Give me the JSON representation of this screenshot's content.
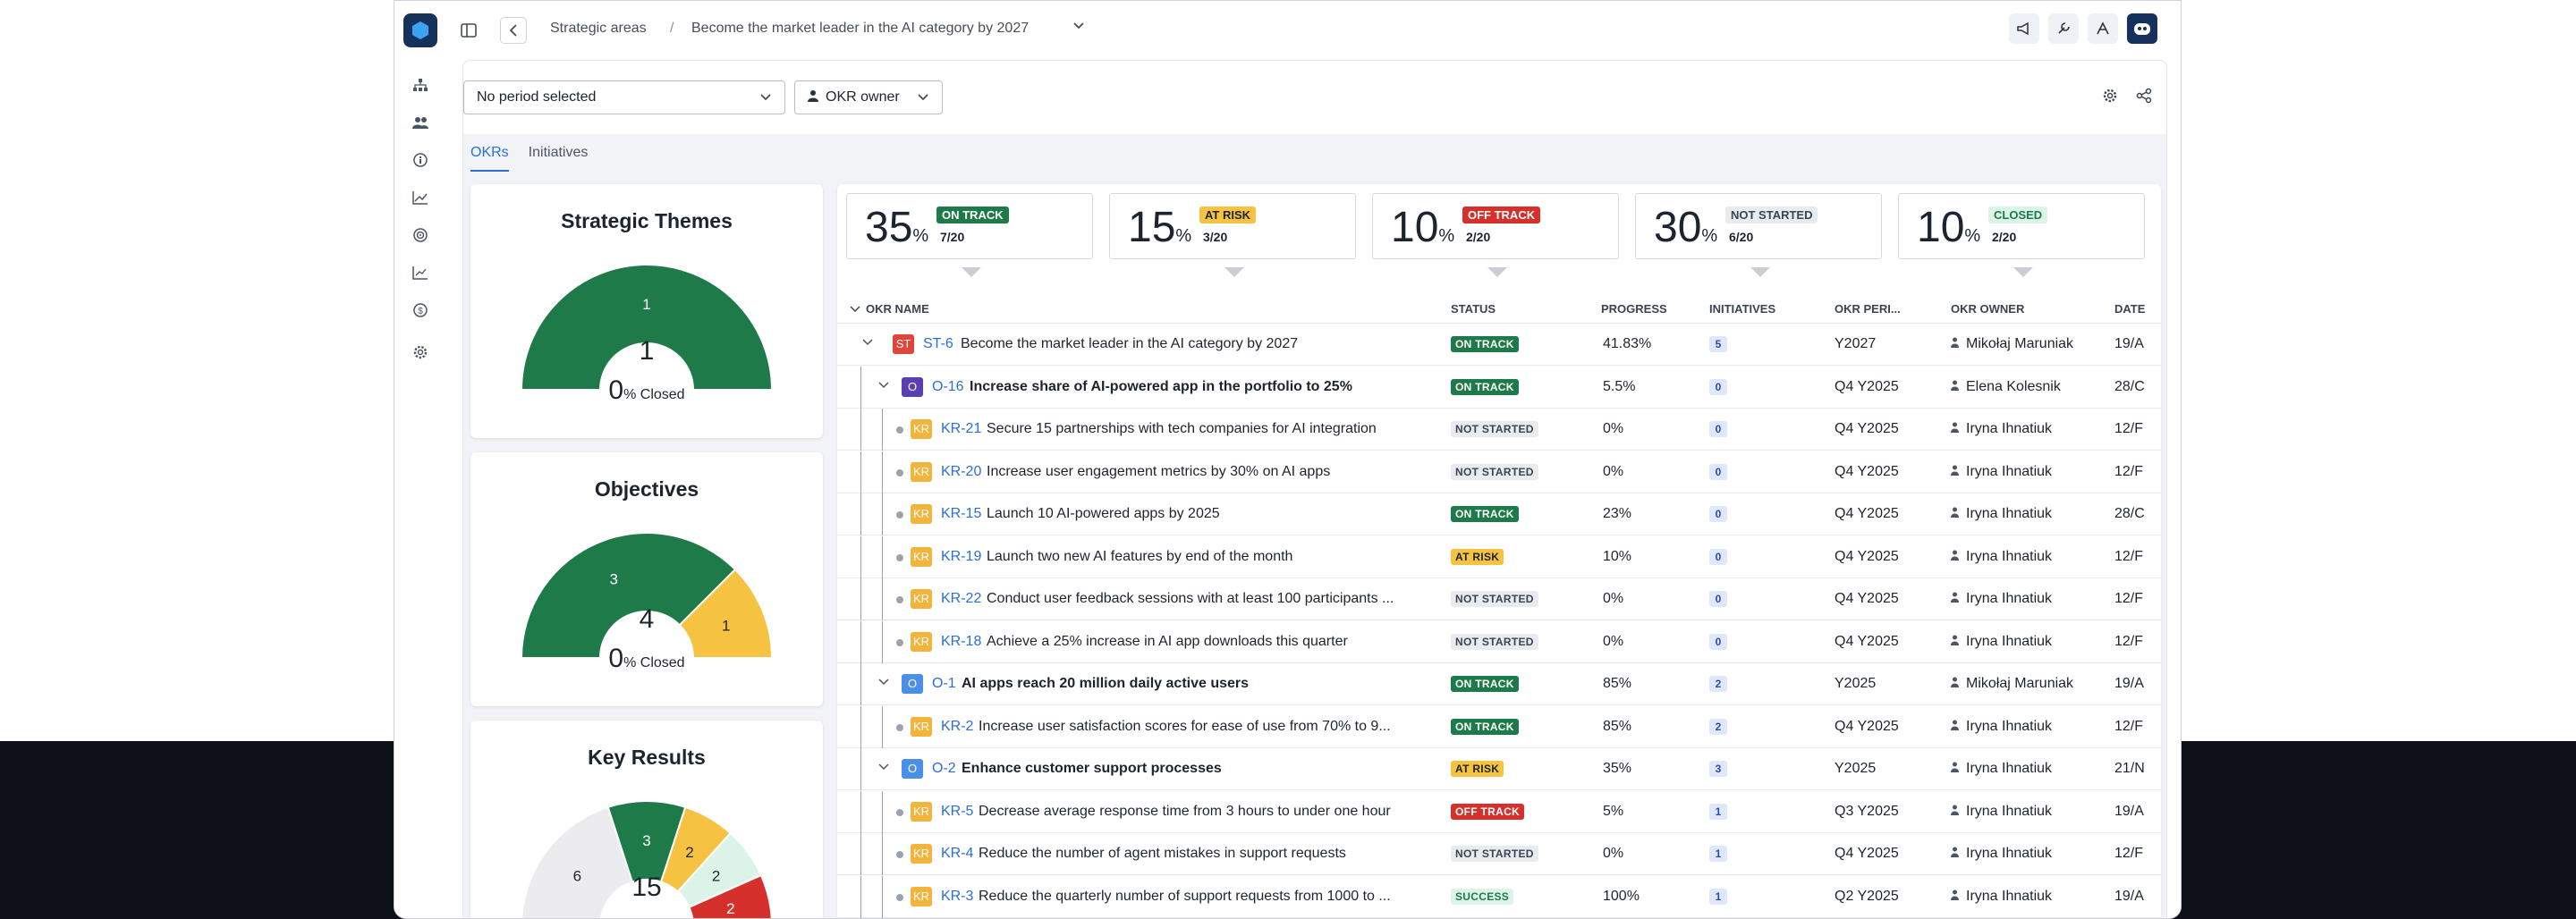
{
  "colors": {
    "on_track": "#1f7a4a",
    "at_risk": "#f5c242",
    "off_track": "#d5302b",
    "not_started": "#e8ebef",
    "closed": "#dcf4e8",
    "st": "#e0453a",
    "o_purple": "#5b3fb0",
    "o_blue": "#4a8fe8",
    "kr": "#f2b43b",
    "link": "#2b6fd6"
  },
  "header": {
    "breadcrumb_root": "Strategic areas",
    "breadcrumb_sep": "/",
    "breadcrumb_current": "Become the market leader in the AI category by 2027"
  },
  "filters": {
    "period": "No period selected",
    "owner": "OKR owner"
  },
  "tabs": [
    {
      "label": "OKRs"
    },
    {
      "label": "Initiatives"
    }
  ],
  "cards": {
    "themes": {
      "title": "Strategic Themes",
      "total": "1",
      "closed_pct": "0",
      "closed_label": "% Closed",
      "segments": [
        {
          "label": "1",
          "value": 1,
          "color": "#1f7a4a"
        }
      ]
    },
    "objectives": {
      "title": "Objectives",
      "total": "4",
      "closed_pct": "0",
      "closed_label": "% Closed",
      "segments": [
        {
          "label": "3",
          "value": 3,
          "color": "#1f7a4a"
        },
        {
          "label": "1",
          "value": 1,
          "color": "#f5c242"
        }
      ]
    },
    "key_results": {
      "title": "Key Results",
      "total": "15",
      "segments": [
        {
          "label": "6",
          "value": 6,
          "color": "#ececef"
        },
        {
          "label": "3",
          "value": 3,
          "color": "#1f7a4a"
        },
        {
          "label": "2",
          "value": 2,
          "color": "#f5c242"
        },
        {
          "label": "2",
          "value": 2,
          "color": "#dcf4e8"
        },
        {
          "label": "2",
          "value": 2,
          "color": "#d5302b"
        }
      ]
    }
  },
  "stats": [
    {
      "pct": "35",
      "unit": "%",
      "label": "ON TRACK",
      "count": "7/20",
      "cls": "b-ontrack"
    },
    {
      "pct": "15",
      "unit": "%",
      "label": "AT RISK",
      "count": "3/20",
      "cls": "b-atrisk"
    },
    {
      "pct": "10",
      "unit": "%",
      "label": "OFF TRACK",
      "count": "2/20",
      "cls": "b-offtrack"
    },
    {
      "pct": "30",
      "unit": "%",
      "label": "NOT STARTED",
      "count": "6/20",
      "cls": "b-notstarted"
    },
    {
      "pct": "10",
      "unit": "%",
      "label": "CLOSED",
      "count": "2/20",
      "cls": "b-closed"
    }
  ],
  "columns": {
    "name": "OKR NAME",
    "status": "STATUS",
    "progress": "PROGRESS",
    "initiatives": "INITIATIVES",
    "period": "OKR PERI...",
    "owner": "OKR OWNER",
    "date": "DATE"
  },
  "rows": [
    {
      "type": "ST",
      "level": 0,
      "code": "ST-6",
      "name": "Become the market leader in the AI category by 2027",
      "status": "ON TRACK",
      "cls": "b-ontrack",
      "progress": "41.83%",
      "initiatives": "5",
      "period": "Y2027",
      "owner": "Mikołaj Maruniak",
      "date": "19/A"
    },
    {
      "type": "O",
      "level": 1,
      "code": "O-16",
      "name": "Increase share of AI-powered app in the portfolio to 25%",
      "status": "ON TRACK",
      "cls": "b-ontrack",
      "progress": "5.5%",
      "initiatives": "0",
      "period": "Q4 Y2025",
      "owner": "Elena Kolesnik",
      "date": "28/C",
      "bold": true,
      "ocolor": "#5b3fb0"
    },
    {
      "type": "KR",
      "level": 2,
      "code": "KR-21",
      "name": "Secure 15 partnerships with tech companies for AI integration",
      "status": "NOT STARTED",
      "cls": "b-notstarted",
      "progress": "0%",
      "initiatives": "0",
      "period": "Q4 Y2025",
      "owner": "Iryna Ihnatiuk",
      "date": "12/F"
    },
    {
      "type": "KR",
      "level": 2,
      "code": "KR-20",
      "name": "Increase user engagement metrics by 30% on AI apps",
      "status": "NOT STARTED",
      "cls": "b-notstarted",
      "progress": "0%",
      "initiatives": "0",
      "period": "Q4 Y2025",
      "owner": "Iryna Ihnatiuk",
      "date": "12/F"
    },
    {
      "type": "KR",
      "level": 2,
      "code": "KR-15",
      "name": "Launch 10 AI-powered apps by 2025",
      "status": "ON TRACK",
      "cls": "b-ontrack",
      "progress": "23%",
      "initiatives": "0",
      "period": "Q4 Y2025",
      "owner": "Iryna Ihnatiuk",
      "date": "28/C"
    },
    {
      "type": "KR",
      "level": 2,
      "code": "KR-19",
      "name": "Launch two new AI features by end of the month",
      "status": "AT RISK",
      "cls": "b-atrisk",
      "progress": "10%",
      "initiatives": "0",
      "period": "Q4 Y2025",
      "owner": "Iryna Ihnatiuk",
      "date": "12/F"
    },
    {
      "type": "KR",
      "level": 2,
      "code": "KR-22",
      "name": "Conduct user feedback sessions with at least 100 participants ...",
      "status": "NOT STARTED",
      "cls": "b-notstarted",
      "progress": "0%",
      "initiatives": "0",
      "period": "Q4 Y2025",
      "owner": "Iryna Ihnatiuk",
      "date": "12/F"
    },
    {
      "type": "KR",
      "level": 2,
      "code": "KR-18",
      "name": "Achieve a 25% increase in AI app downloads this quarter",
      "status": "NOT STARTED",
      "cls": "b-notstarted",
      "progress": "0%",
      "initiatives": "0",
      "period": "Q4 Y2025",
      "owner": "Iryna Ihnatiuk",
      "date": "12/F"
    },
    {
      "type": "O",
      "level": 1,
      "code": "O-1",
      "name": "AI apps reach 20 million daily active users",
      "status": "ON TRACK",
      "cls": "b-ontrack",
      "progress": "85%",
      "initiatives": "2",
      "period": "Y2025",
      "owner": "Mikołaj Maruniak",
      "date": "19/A",
      "bold": true,
      "ocolor": "#4a8fe8"
    },
    {
      "type": "KR",
      "level": 2,
      "code": "KR-2",
      "name": "Increase user satisfaction scores for ease of use from 70% to 9...",
      "status": "ON TRACK",
      "cls": "b-ontrack",
      "progress": "85%",
      "initiatives": "2",
      "period": "Q4 Y2025",
      "owner": "Iryna Ihnatiuk",
      "date": "12/F"
    },
    {
      "type": "O",
      "level": 1,
      "code": "O-2",
      "name": "Enhance customer support processes",
      "status": "AT RISK",
      "cls": "b-atrisk",
      "progress": "35%",
      "initiatives": "3",
      "period": "Y2025",
      "owner": "Iryna Ihnatiuk",
      "date": "21/N",
      "bold": true,
      "ocolor": "#4a8fe8"
    },
    {
      "type": "KR",
      "level": 2,
      "code": "KR-5",
      "name": "Decrease average response time from 3 hours to under one hour",
      "status": "OFF TRACK",
      "cls": "b-offtrack",
      "progress": "5%",
      "initiatives": "1",
      "period": "Q3 Y2025",
      "owner": "Iryna Ihnatiuk",
      "date": "19/A"
    },
    {
      "type": "KR",
      "level": 2,
      "code": "KR-4",
      "name": "Reduce the number of agent mistakes in support requests",
      "status": "NOT STARTED",
      "cls": "b-notstarted",
      "progress": "0%",
      "initiatives": "1",
      "period": "Q4 Y2025",
      "owner": "Iryna Ihnatiuk",
      "date": "12/F"
    },
    {
      "type": "KR",
      "level": 2,
      "code": "KR-3",
      "name": "Reduce the quarterly number of support requests from 1000 to ...",
      "status": "SUCCESS",
      "cls": "b-success",
      "progress": "100%",
      "initiatives": "1",
      "period": "Q2 Y2025",
      "owner": "Iryna Ihnatiuk",
      "date": "19/A"
    }
  ]
}
